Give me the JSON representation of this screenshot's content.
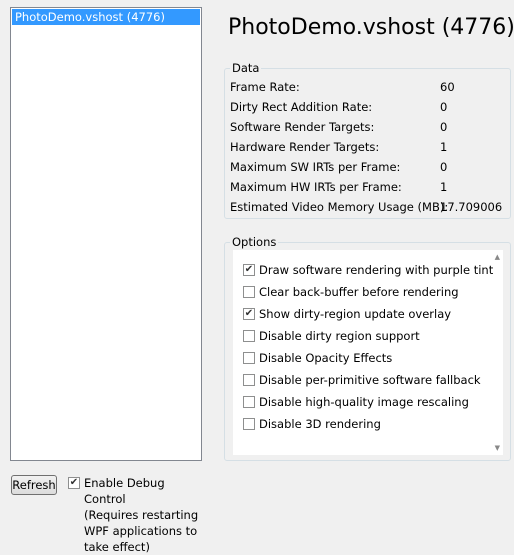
{
  "process_list": {
    "items": [
      "PhotoDemo.vshost (4776)"
    ]
  },
  "refresh_button": "Refresh",
  "debug_control": {
    "checked": true,
    "label_lines": [
      "Enable Debug Control",
      "(Requires restarting",
      "WPF applications to",
      "take effect)"
    ]
  },
  "title": "PhotoDemo.vshost (4776)",
  "data_group": {
    "legend": "Data",
    "rows": [
      {
        "label": "Frame Rate:",
        "value": "60"
      },
      {
        "label": "Dirty Rect Addition Rate:",
        "value": "0"
      },
      {
        "label": "Software Render Targets:",
        "value": "0"
      },
      {
        "label": "Hardware Render Targets:",
        "value": "1"
      },
      {
        "label": "Maximum SW IRTs per Frame:",
        "value": "0"
      },
      {
        "label": "Maximum HW IRTs per Frame:",
        "value": "1"
      },
      {
        "label": "Estimated Video Memory Usage (MB):",
        "value": "17.709006"
      }
    ]
  },
  "options_group": {
    "legend": "Options",
    "items": [
      {
        "label": "Draw software rendering with purple tint",
        "checked": true
      },
      {
        "label": "Clear back-buffer before rendering",
        "checked": false
      },
      {
        "label": "Show dirty-region update overlay",
        "checked": true
      },
      {
        "label": "Disable dirty region support",
        "checked": false
      },
      {
        "label": "Disable Opacity Effects",
        "checked": false
      },
      {
        "label": "Disable per-primitive software fallback",
        "checked": false
      },
      {
        "label": "Disable high-quality image rescaling",
        "checked": false
      },
      {
        "label": "Disable 3D rendering",
        "checked": false
      }
    ]
  },
  "icons": {
    "scroll_up": "scroll-up-arrow-icon",
    "scroll_down": "scroll-down-arrow-icon",
    "check": "checkmark-icon"
  }
}
